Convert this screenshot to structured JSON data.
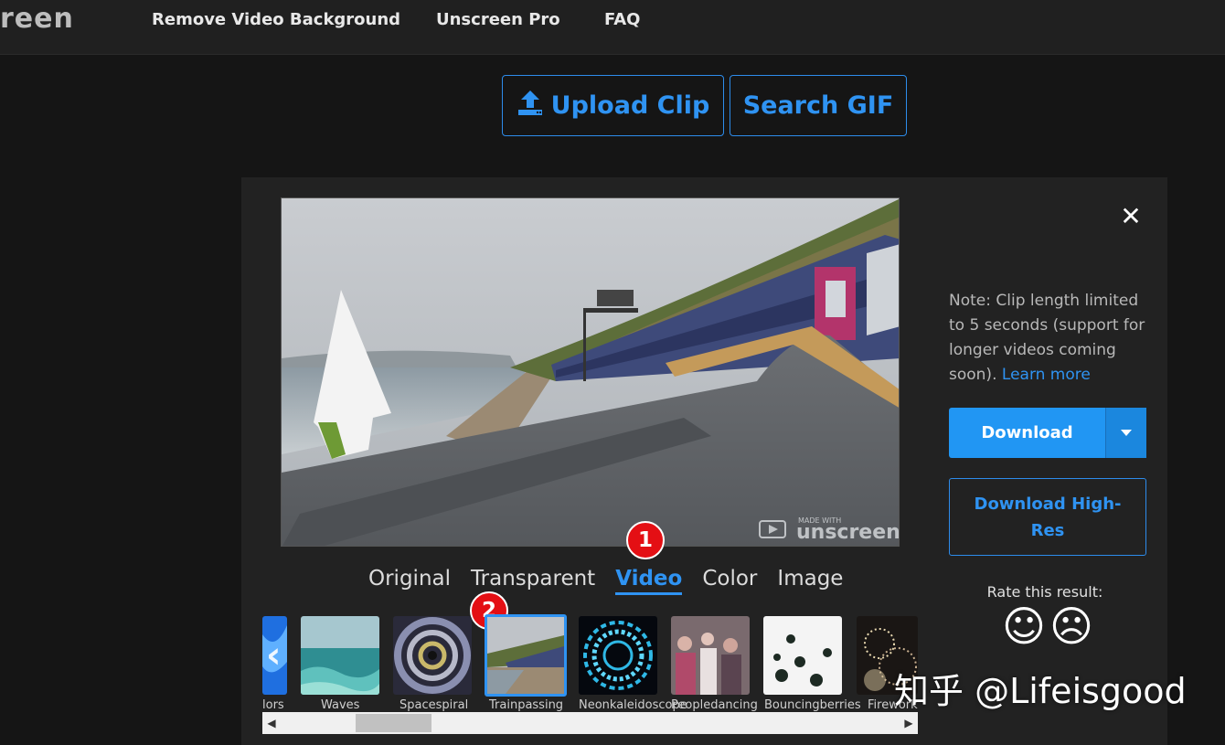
{
  "nav": {
    "logo": "reen",
    "links": [
      "Remove Video Background",
      "Unscreen Pro",
      "FAQ"
    ]
  },
  "actions": {
    "upload": "Upload Clip",
    "search": "Search GIF"
  },
  "preview": {
    "watermark_small": "MADE WITH",
    "watermark_brand": "unscreen"
  },
  "sidebar": {
    "close": "✕",
    "note_text": "Note: Clip length limited to 5 seconds (support for longer videos coming soon).",
    "note_link": "Learn more",
    "download": "Download",
    "download_hires": "Download High-Res",
    "rate_label": "Rate this result:",
    "rate_good": "☺",
    "rate_bad": "☹"
  },
  "tabs": [
    {
      "label": "Original",
      "active": false
    },
    {
      "label": "Transparent",
      "active": false
    },
    {
      "label": "Video",
      "active": true
    },
    {
      "label": "Color",
      "active": false
    },
    {
      "label": "Image",
      "active": false
    }
  ],
  "badges": [
    "1",
    "2"
  ],
  "thumbnails": [
    {
      "label": "lors"
    },
    {
      "label": "Waves"
    },
    {
      "label": "Spacespiral"
    },
    {
      "label": "Trainpassing",
      "selected": true
    },
    {
      "label": "Neonkaleidoscope"
    },
    {
      "label": "Peopledancing"
    },
    {
      "label": "Bouncingberries"
    },
    {
      "label": "Firework"
    }
  ],
  "overlay_watermark": "知乎 @Lifeisgood",
  "colors": {
    "accent": "#2196f3",
    "background": "#151515",
    "panel": "#222222",
    "badge": "#e40f14"
  }
}
